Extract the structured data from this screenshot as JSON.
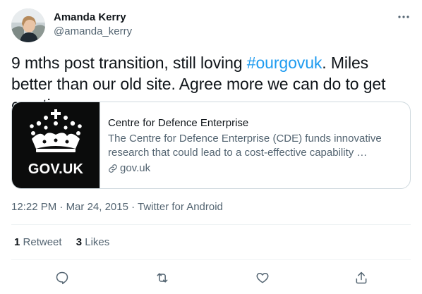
{
  "author": {
    "name": "Amanda Kerry",
    "handle": "@amanda_kerry"
  },
  "tweet": {
    "text_before": "9 mths post transition, still loving ",
    "hashtag": "#ourgovuk",
    "text_after": ". Miles better than our old site. Agree more we can do to get creative"
  },
  "card": {
    "thumb_label": "GOV.UK",
    "title": "Centre for Defence Enterprise",
    "description": "The Centre for Defence Enterprise (CDE) funds innovative research that could lead to a cost-effective capability …",
    "domain": "gov.uk"
  },
  "meta": {
    "time": "12:22 PM",
    "separator": " · ",
    "date": "Mar 24, 2015",
    "source": "Twitter for Android"
  },
  "stats": {
    "retweets_count": "1",
    "retweets_label": "Retweet",
    "likes_count": "3",
    "likes_label": "Likes"
  },
  "icons": {
    "more": "more-horizontal-icon",
    "reply": "reply-icon",
    "retweet": "retweet-icon",
    "like": "heart-icon",
    "share": "share-icon",
    "link": "link-icon"
  },
  "colors": {
    "accent": "#1d9bf0",
    "secondary_text": "#536471",
    "primary_text": "#0f1419",
    "border": "#cfd9de",
    "card_thumb_bg": "#0b0c0c"
  }
}
